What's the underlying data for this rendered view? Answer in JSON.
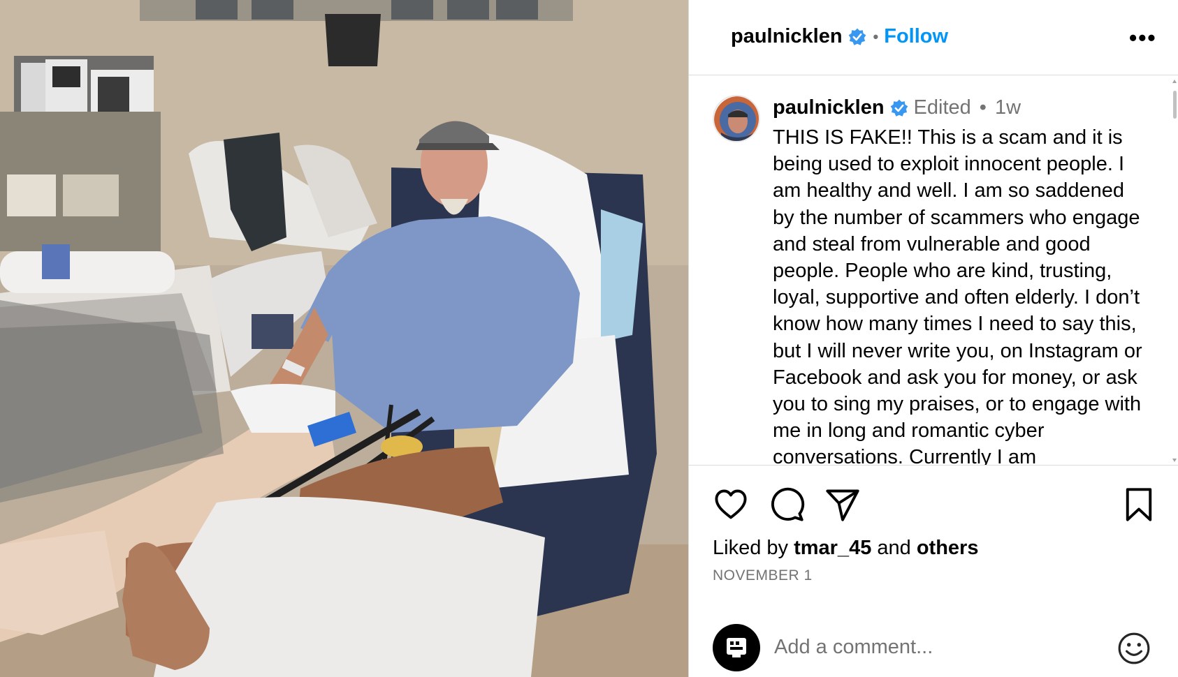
{
  "header": {
    "username": "paulnicklen",
    "separator": "•",
    "follow_label": "Follow",
    "more_label": "•••",
    "verified_icon": "verified-badge-icon"
  },
  "caption": {
    "username": "paulnicklen",
    "edited_label": "Edited",
    "separator": "•",
    "time": "1w",
    "text": "THIS IS FAKE!! This is a scam and it is being used to exploit innocent people. I am healthy and well. I am so saddened by the number of scammers who engage and steal from vulnerable and good people. People who are kind, trusting, loyal, supportive and often elderly. I don’t know how many times I need to say this, but I will never write you, on Instagram or Facebook and ask you for money, or ask you to sing my praises, or to engage with me in long and romantic cyber conversations. Currently I am"
  },
  "actions": {
    "like_icon": "heart-icon",
    "comment_icon": "comment-icon",
    "share_icon": "send-icon",
    "save_icon": "bookmark-icon"
  },
  "likes": {
    "prefix": "Liked by",
    "user": "tmar_45",
    "connector": "and",
    "others": "others"
  },
  "date": "NOVEMBER 1",
  "comment": {
    "placeholder": "Add a comment...",
    "emoji_icon": "emoji-icon"
  },
  "colors": {
    "accent": "#0095f6",
    "verified": "#3897f0",
    "muted": "#737373",
    "divider": "#dbdbdb"
  }
}
